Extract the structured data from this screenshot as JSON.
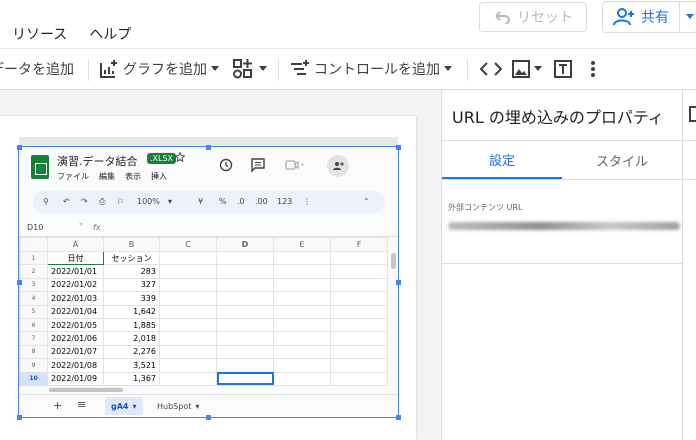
{
  "menu": [
    "リソース",
    "ヘルプ"
  ],
  "header": {
    "reset_label": "リセット",
    "share_label": "共有"
  },
  "toolbar": {
    "add_data": "データを追加",
    "add_chart": "グラフを追加",
    "add_control": "コントロールを追加"
  },
  "panel": {
    "title": "URL の埋め込みのプロパティ",
    "tabs": [
      {
        "label": "設定",
        "active": true
      },
      {
        "label": "スタイル",
        "active": false
      }
    ],
    "field_label": "外部コンテンツ URL"
  },
  "spreadsheet": {
    "title": "演習.データ結合",
    "badge": ".XLSX",
    "menu": [
      "ファイル",
      "編集",
      "表示",
      "挿入"
    ],
    "zoom": "100%",
    "tools": [
      "¥",
      "%",
      ".0",
      ".00",
      "123"
    ],
    "namebox": "D10",
    "fx": "fx",
    "columns": [
      "A",
      "B",
      "C",
      "D",
      "E",
      "F"
    ],
    "header_row": [
      "日付",
      "セッション"
    ],
    "rows": [
      [
        "2022/01/01",
        "283"
      ],
      [
        "2022/01/02",
        "327"
      ],
      [
        "2022/01/03",
        "339"
      ],
      [
        "2022/01/04",
        "1,642"
      ],
      [
        "2022/01/05",
        "1,885"
      ],
      [
        "2022/01/06",
        "2,018"
      ],
      [
        "2022/01/07",
        "2,276"
      ],
      [
        "2022/01/08",
        "3,521"
      ],
      [
        "2022/01/09",
        "1,367"
      ]
    ],
    "row_numbers": [
      "1",
      "2",
      "3",
      "4",
      "5",
      "6",
      "7",
      "8",
      "9",
      "10"
    ],
    "sheets": [
      {
        "label": "gA4",
        "active": true
      },
      {
        "label": "HubSpot",
        "active": false
      }
    ]
  },
  "colors": {
    "accent": "#1a73e8",
    "sheets_green": "#188038",
    "selection": "#4285f4"
  }
}
